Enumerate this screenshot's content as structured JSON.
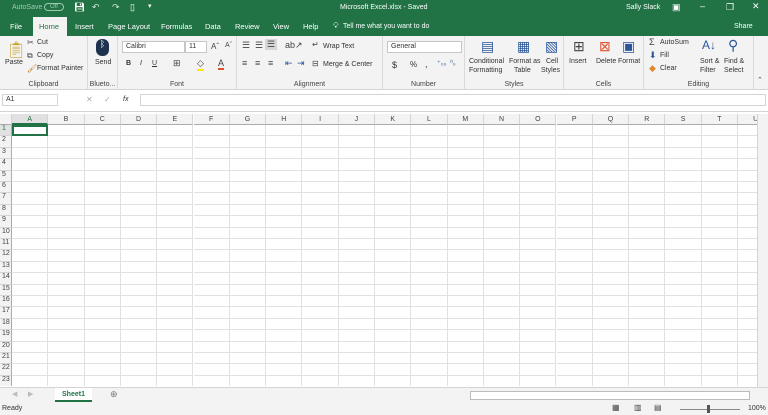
{
  "titlebar": {
    "autosave": "AutoSave",
    "autosave_state": "Off",
    "title": "Microsoft Excel.xlsx  -  Saved",
    "user": "Sally Slack"
  },
  "tabs": [
    "File",
    "Home",
    "Insert",
    "Page Layout",
    "Formulas",
    "Data",
    "Review",
    "View",
    "Help"
  ],
  "tell_me": "Tell me what you want to do",
  "share": "Share",
  "ribbon": {
    "clipboard": {
      "paste": "Paste",
      "cut": "Cut",
      "copy": "Copy",
      "format_painter": "Format Painter",
      "label": "Clipboard"
    },
    "bluetooth": {
      "send": "Send",
      "label": "Blueto..."
    },
    "font": {
      "name": "Calibri",
      "size": "11",
      "bold": "B",
      "italic": "I",
      "underline": "U",
      "label": "Font"
    },
    "alignment": {
      "wrap": "Wrap Text",
      "merge": "Merge & Center",
      "label": "Alignment"
    },
    "number": {
      "format": "General",
      "currency": "$",
      "percent": "%",
      "comma": ",",
      "label": "Number"
    },
    "styles": {
      "conditional": "Conditional",
      "conditional2": "Formatting",
      "format_table": "Format as",
      "format_table2": "Table",
      "cell": "Cell",
      "cell2": "Styles",
      "label": "Styles"
    },
    "cells": {
      "insert": "Insert",
      "delete": "Delete",
      "format": "Format",
      "label": "Cells"
    },
    "editing": {
      "autosum": "AutoSum",
      "fill": "Fill",
      "clear": "Clear",
      "sort": "Sort &",
      "sort2": "Filter",
      "find": "Find &",
      "find2": "Select",
      "label": "Editing"
    }
  },
  "formula_bar": {
    "name_box": "A1",
    "fx": "fx",
    "value": ""
  },
  "columns": [
    "A",
    "B",
    "C",
    "D",
    "E",
    "F",
    "G",
    "H",
    "I",
    "J",
    "K",
    "L",
    "M",
    "N",
    "O",
    "P",
    "Q",
    "R",
    "S",
    "T",
    "U"
  ],
  "rows": [
    "1",
    "2",
    "3",
    "4",
    "5",
    "6",
    "7",
    "8",
    "9",
    "10",
    "11",
    "12",
    "13",
    "14",
    "15",
    "16",
    "17",
    "18",
    "19",
    "20",
    "21",
    "22",
    "23"
  ],
  "selected_cell": "A1",
  "sheets": [
    "Sheet1"
  ],
  "status": {
    "ready": "Ready",
    "zoom": "100%"
  },
  "colors": {
    "accent": "#217346"
  }
}
